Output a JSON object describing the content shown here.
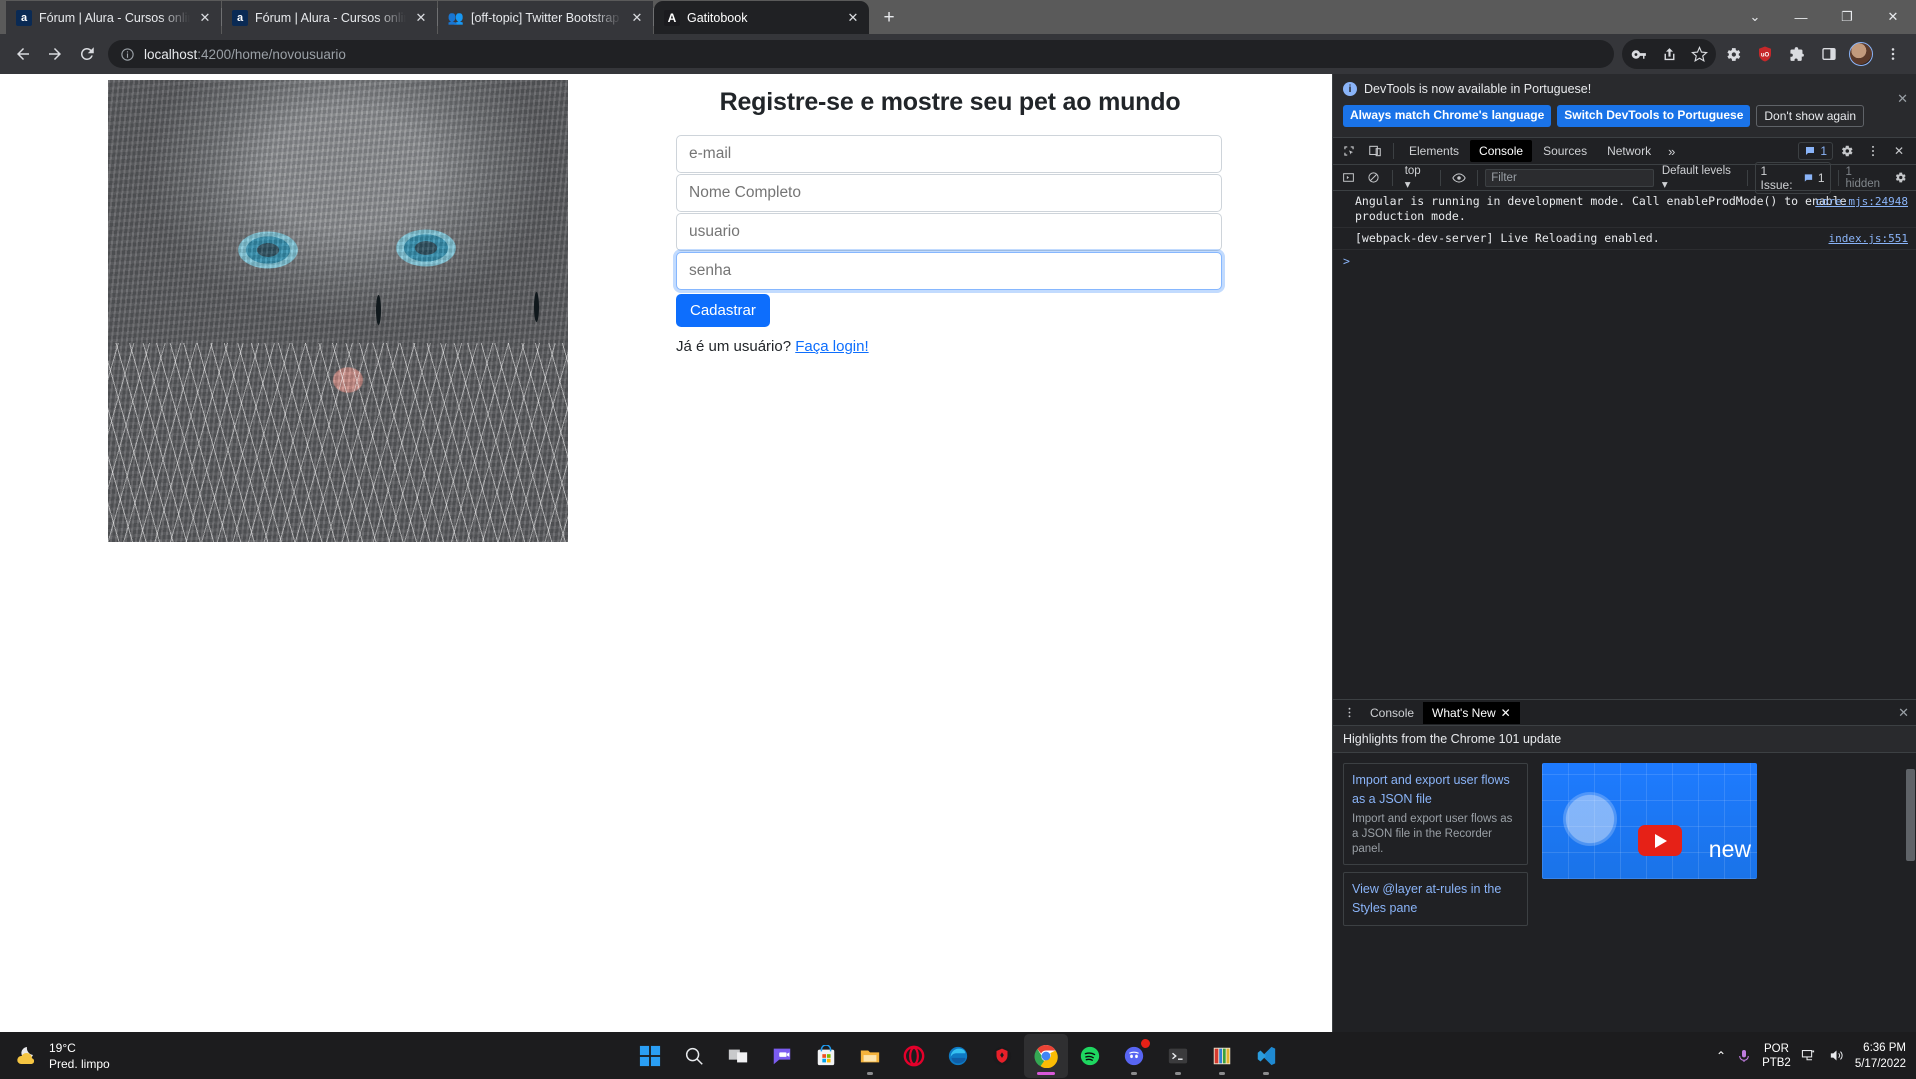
{
  "browser": {
    "tabs": [
      {
        "title": "Fórum | Alura - Cursos online de",
        "favicon": "alura-icon",
        "active": false
      },
      {
        "title": "Fórum | Alura - Cursos online de",
        "favicon": "alura-icon",
        "active": false
      },
      {
        "title": "[off-topic] Twitter Bootstrap - Co",
        "favicon": "people-icon",
        "active": false
      },
      {
        "title": "Gatitobook",
        "favicon": "angular-icon",
        "active": true
      }
    ],
    "new_tab_label": "+",
    "window_controls": {
      "tab_search": "⌄",
      "minimize": "—",
      "maximize": "❐",
      "close": "✕"
    },
    "omnibox": {
      "host": "localhost",
      "path": ":4200/home/novousuario",
      "full": "localhost:4200/home/novousuario"
    },
    "nav": {
      "back": "←",
      "forward": "→",
      "reload": "⟳"
    },
    "toolbar_icons": [
      "key-icon",
      "share-icon",
      "bookmark-star-icon",
      "gear-icon",
      "ublock-shield-icon",
      "extensions-puzzle-icon",
      "side-panel-icon",
      "profile-avatar",
      "chrome-menu-icon"
    ]
  },
  "page": {
    "title": "Registre-se e mostre seu pet ao mundo",
    "image_alt": "gray-tabby-cat-with-blue-eyes",
    "fields": [
      {
        "name": "email",
        "placeholder": "e-mail",
        "value": "",
        "focused": false
      },
      {
        "name": "fullname",
        "placeholder": "Nome Completo",
        "value": "",
        "focused": false
      },
      {
        "name": "username",
        "placeholder": "usuario",
        "value": "",
        "focused": false
      },
      {
        "name": "password",
        "placeholder": "senha",
        "value": "",
        "focused": true
      }
    ],
    "submit_label": "Cadastrar",
    "login_prompt": "Já é um usuário?",
    "login_link": "Faça login!"
  },
  "devtools": {
    "banner": {
      "message": "DevTools is now available in Portuguese!",
      "primary_button": "Always match Chrome's language",
      "secondary_button": "Switch DevTools to Portuguese",
      "tertiary_button": "Don't show again",
      "close": "✕"
    },
    "tabs": [
      {
        "label": "Elements",
        "active": false
      },
      {
        "label": "Console",
        "active": true
      },
      {
        "label": "Sources",
        "active": false
      },
      {
        "label": "Network",
        "active": false
      }
    ],
    "more_tabs": "»",
    "issues_count": "1",
    "toolbar_right_icons": [
      "settings-gear-icon",
      "kebab-menu-icon",
      "close-devtools-icon"
    ],
    "subbar": {
      "context": "top",
      "filter_placeholder": "Filter",
      "levels": "Default levels",
      "issue_chip": "1 Issue:",
      "issue_chip_count": "1",
      "hidden": "1 hidden"
    },
    "console_messages": [
      {
        "text": "Angular is running in development mode. Call enableProdMode() to enable production mode.",
        "source": "core.mjs:24948"
      },
      {
        "text": "[webpack-dev-server] Live Reloading enabled.",
        "source": "index.js:551"
      }
    ],
    "prompt": ">",
    "drawer": {
      "tabs": [
        {
          "label": "Console",
          "active": false
        },
        {
          "label": "What's New",
          "active": true,
          "closable": "✕"
        }
      ],
      "close": "✕",
      "heading": "Highlights from the Chrome 101 update",
      "cards": [
        {
          "title": "Import and export user flows as a JSON file",
          "description": "Import and export user flows as a JSON file in the Recorder panel."
        },
        {
          "title": "View @layer at-rules in the Styles pane",
          "description": ""
        }
      ],
      "video_caption": "new"
    }
  },
  "taskbar": {
    "weather": {
      "temperature": "19°C",
      "condition": "Pred. limpo",
      "icon": "moon-cloud-icon"
    },
    "apps": [
      {
        "name": "start-button",
        "icon": "windows-logo-icon",
        "running": false,
        "active": false
      },
      {
        "name": "search",
        "icon": "search-icon",
        "running": false,
        "active": false
      },
      {
        "name": "task-view",
        "icon": "task-view-icon",
        "running": false,
        "active": false
      },
      {
        "name": "chat",
        "icon": "chat-teams-icon",
        "running": false,
        "active": false
      },
      {
        "name": "microsoft-store",
        "icon": "store-icon",
        "running": false,
        "active": false
      },
      {
        "name": "file-explorer",
        "icon": "folder-icon",
        "running": true,
        "active": false
      },
      {
        "name": "opera",
        "icon": "opera-icon",
        "running": false,
        "active": false
      },
      {
        "name": "edge",
        "icon": "edge-icon",
        "running": false,
        "active": false
      },
      {
        "name": "brave-or-shield-app",
        "icon": "red-shield-icon",
        "running": false,
        "active": false
      },
      {
        "name": "chrome",
        "icon": "chrome-icon",
        "running": true,
        "active": true
      },
      {
        "name": "spotify",
        "icon": "spotify-icon",
        "running": true,
        "active": false
      },
      {
        "name": "discord",
        "icon": "discord-icon",
        "running": true,
        "active": false,
        "badge": "1"
      },
      {
        "name": "terminal",
        "icon": "terminal-icon",
        "running": true,
        "active": false
      },
      {
        "name": "winrar",
        "icon": "winrar-icon",
        "running": true,
        "active": false
      },
      {
        "name": "vscode",
        "icon": "vscode-icon",
        "running": true,
        "active": false
      }
    ],
    "tray": {
      "chevron": "⌃",
      "mic": "mic-icon",
      "language_line1": "POR",
      "language_line2": "PTB2",
      "network": "network-icon",
      "volume": "volume-icon",
      "time": "6:36 PM",
      "date": "5/17/2022"
    }
  }
}
